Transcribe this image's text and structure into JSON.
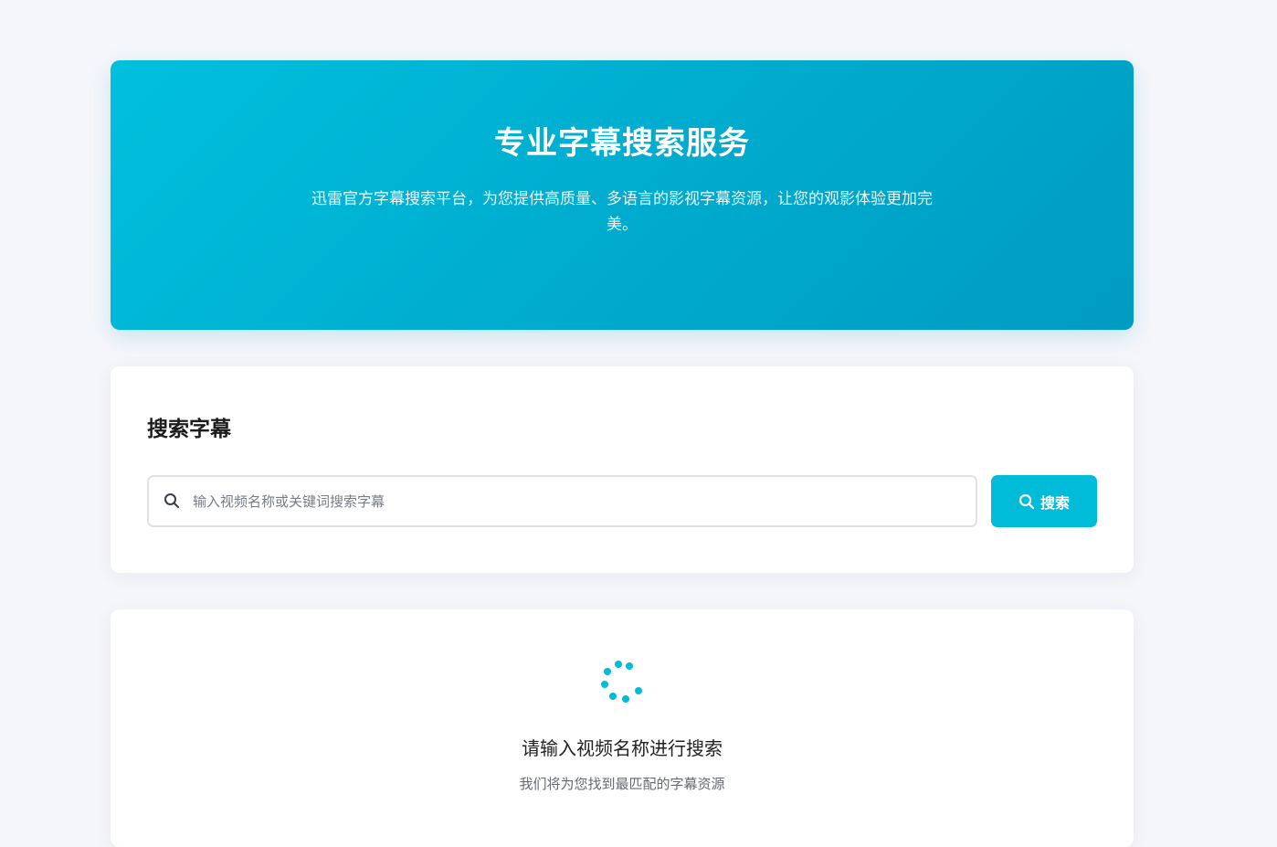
{
  "hero": {
    "title": "专业字幕搜索服务",
    "subtitle": "迅雷官方字幕搜索平台，为您提供高质量、多语言的影视字幕资源，让您的观影体验更加完美。"
  },
  "search": {
    "title": "搜索字幕",
    "placeholder": "输入视频名称或关键词搜索字幕",
    "value": "",
    "button_label": "搜索",
    "icon": "search-icon"
  },
  "results": {
    "loading_icon": "spinner-icon",
    "empty_title": "请输入视频名称进行搜索",
    "empty_subtitle": "我们将为您找到最匹配的字幕资源"
  },
  "colors": {
    "accent": "#00bcd8",
    "hero_gradient_start": "#00c0dd",
    "hero_gradient_end": "#009bc2",
    "background": "#f5f6fa"
  }
}
